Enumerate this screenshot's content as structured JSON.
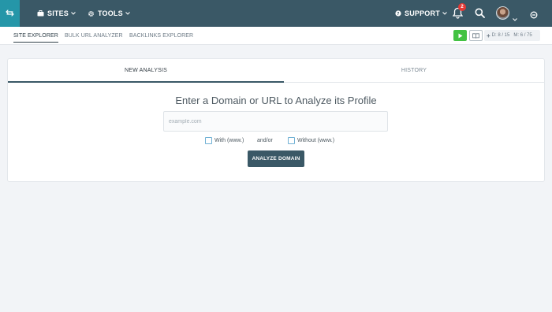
{
  "topbar": {
    "sites_label": "SITES",
    "tools_label": "TOOLS",
    "support_label": "SUPPORT",
    "notification_count": "2",
    "colors": {
      "bar": "#3a5866",
      "logo_box": "#2596a8",
      "badge": "#e53935"
    }
  },
  "subnav": {
    "tabs": [
      {
        "label": "SITE EXPLORER",
        "active": true
      },
      {
        "label": "BULK URL ANALYZER",
        "active": false
      },
      {
        "label": "BACKLINKS EXPLORER",
        "active": false
      }
    ],
    "quota": {
      "plus": "+",
      "d": "D: 8 / 15",
      "m": "M: 6 / 75"
    }
  },
  "main": {
    "tabs": [
      {
        "label": "NEW ANALYSIS",
        "active": true
      },
      {
        "label": "HISTORY",
        "active": false
      }
    ],
    "headline": "Enter a Domain or URL to Analyze its Profile",
    "input": {
      "placeholder": "example.com",
      "value": ""
    },
    "options": {
      "with_www": "With (www.)",
      "and_or": "and/or",
      "without_www": "Without (www.)"
    },
    "analyze_button": "ANALYZE DOMAIN"
  },
  "icons": [
    "back-arrow-icon",
    "briefcase-icon",
    "gear-icon",
    "chevron-down-icon",
    "help-icon",
    "bell-icon",
    "search-icon",
    "avatar",
    "power-icon",
    "play-icon",
    "book-icon",
    "plus-icon"
  ]
}
